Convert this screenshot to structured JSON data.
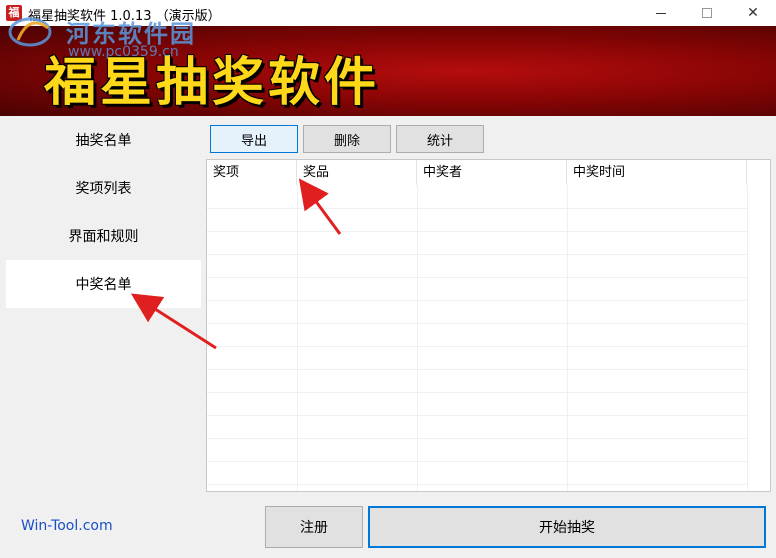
{
  "window": {
    "title": "福星抽奖软件 1.0.13 （演示版）",
    "app_icon_glyph": "福",
    "minimize_glyph": "—",
    "maximize_glyph": "☐",
    "close_glyph": "✕"
  },
  "banner": {
    "title": "福星抽奖软件"
  },
  "watermark": {
    "text": "河东软件园",
    "url": "www.pc0359.cn"
  },
  "sidebar": {
    "items": [
      {
        "label": "抽奖名单"
      },
      {
        "label": "奖项列表"
      },
      {
        "label": "界面和规则"
      },
      {
        "label": "中奖名单",
        "active": true
      }
    ]
  },
  "toolbar": {
    "export_label": "导出",
    "delete_label": "删除",
    "stats_label": "统计"
  },
  "table": {
    "columns": [
      "奖项",
      "奖品",
      "中奖者",
      "中奖时间"
    ],
    "rows": []
  },
  "footer": {
    "site_link": "Win-Tool.com",
    "register_label": "注册",
    "start_label": "开始抽奖"
  },
  "colors": {
    "banner_red": "#8a0505",
    "banner_text": "#ffd81a",
    "accent_blue": "#0078d7",
    "annotation_arrow": "#e02020"
  }
}
